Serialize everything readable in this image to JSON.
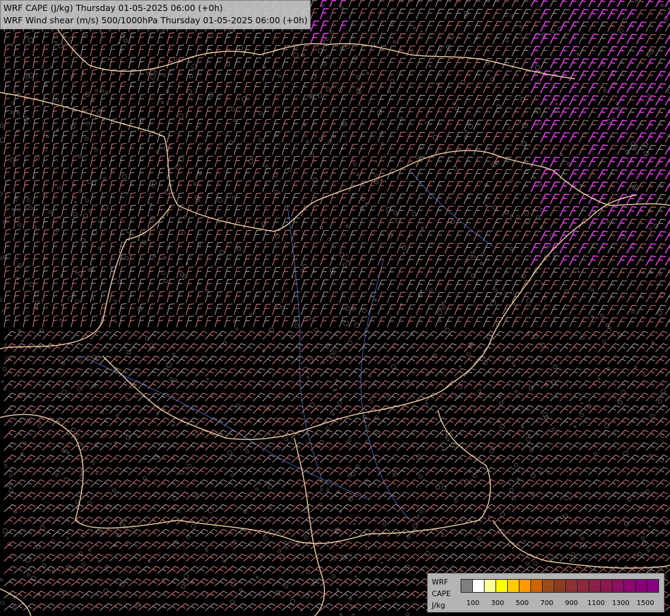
{
  "title": {
    "line1": "WRF CAPE (J/kg) Thursday 01-05-2025 06:00 (+0h)",
    "line2": "WRF Wind shear (m/s) 500/1000hPa Thursday 01-05-2025 06:00 (+0h)"
  },
  "legend": {
    "model": "WRF",
    "field": "CAPE",
    "unit": "J/kg",
    "swatch_colors": [
      "#808080",
      "#ffffff",
      "#ffff99",
      "#ffff00",
      "#ffcc00",
      "#ff9900",
      "#cc6600",
      "#994c19",
      "#8c3c1e",
      "#8c3032",
      "#8c283c",
      "#8c2046",
      "#8c1850",
      "#8c1060",
      "#8c0870",
      "#8a0078",
      "#880080"
    ],
    "tick_labels": [
      "100",
      "300",
      "500",
      "700",
      "900",
      "1100",
      "1300",
      "1500"
    ]
  },
  "map": {
    "background": "#000000",
    "barb_colors": [
      "#c87878",
      "#b48c8c",
      "#e08080",
      "#c0a0a0"
    ],
    "strong_barb_color": "#e040e0",
    "border_color": "#e6c8a0",
    "river_color": "#3c64b4",
    "relief_color": "#808080"
  }
}
